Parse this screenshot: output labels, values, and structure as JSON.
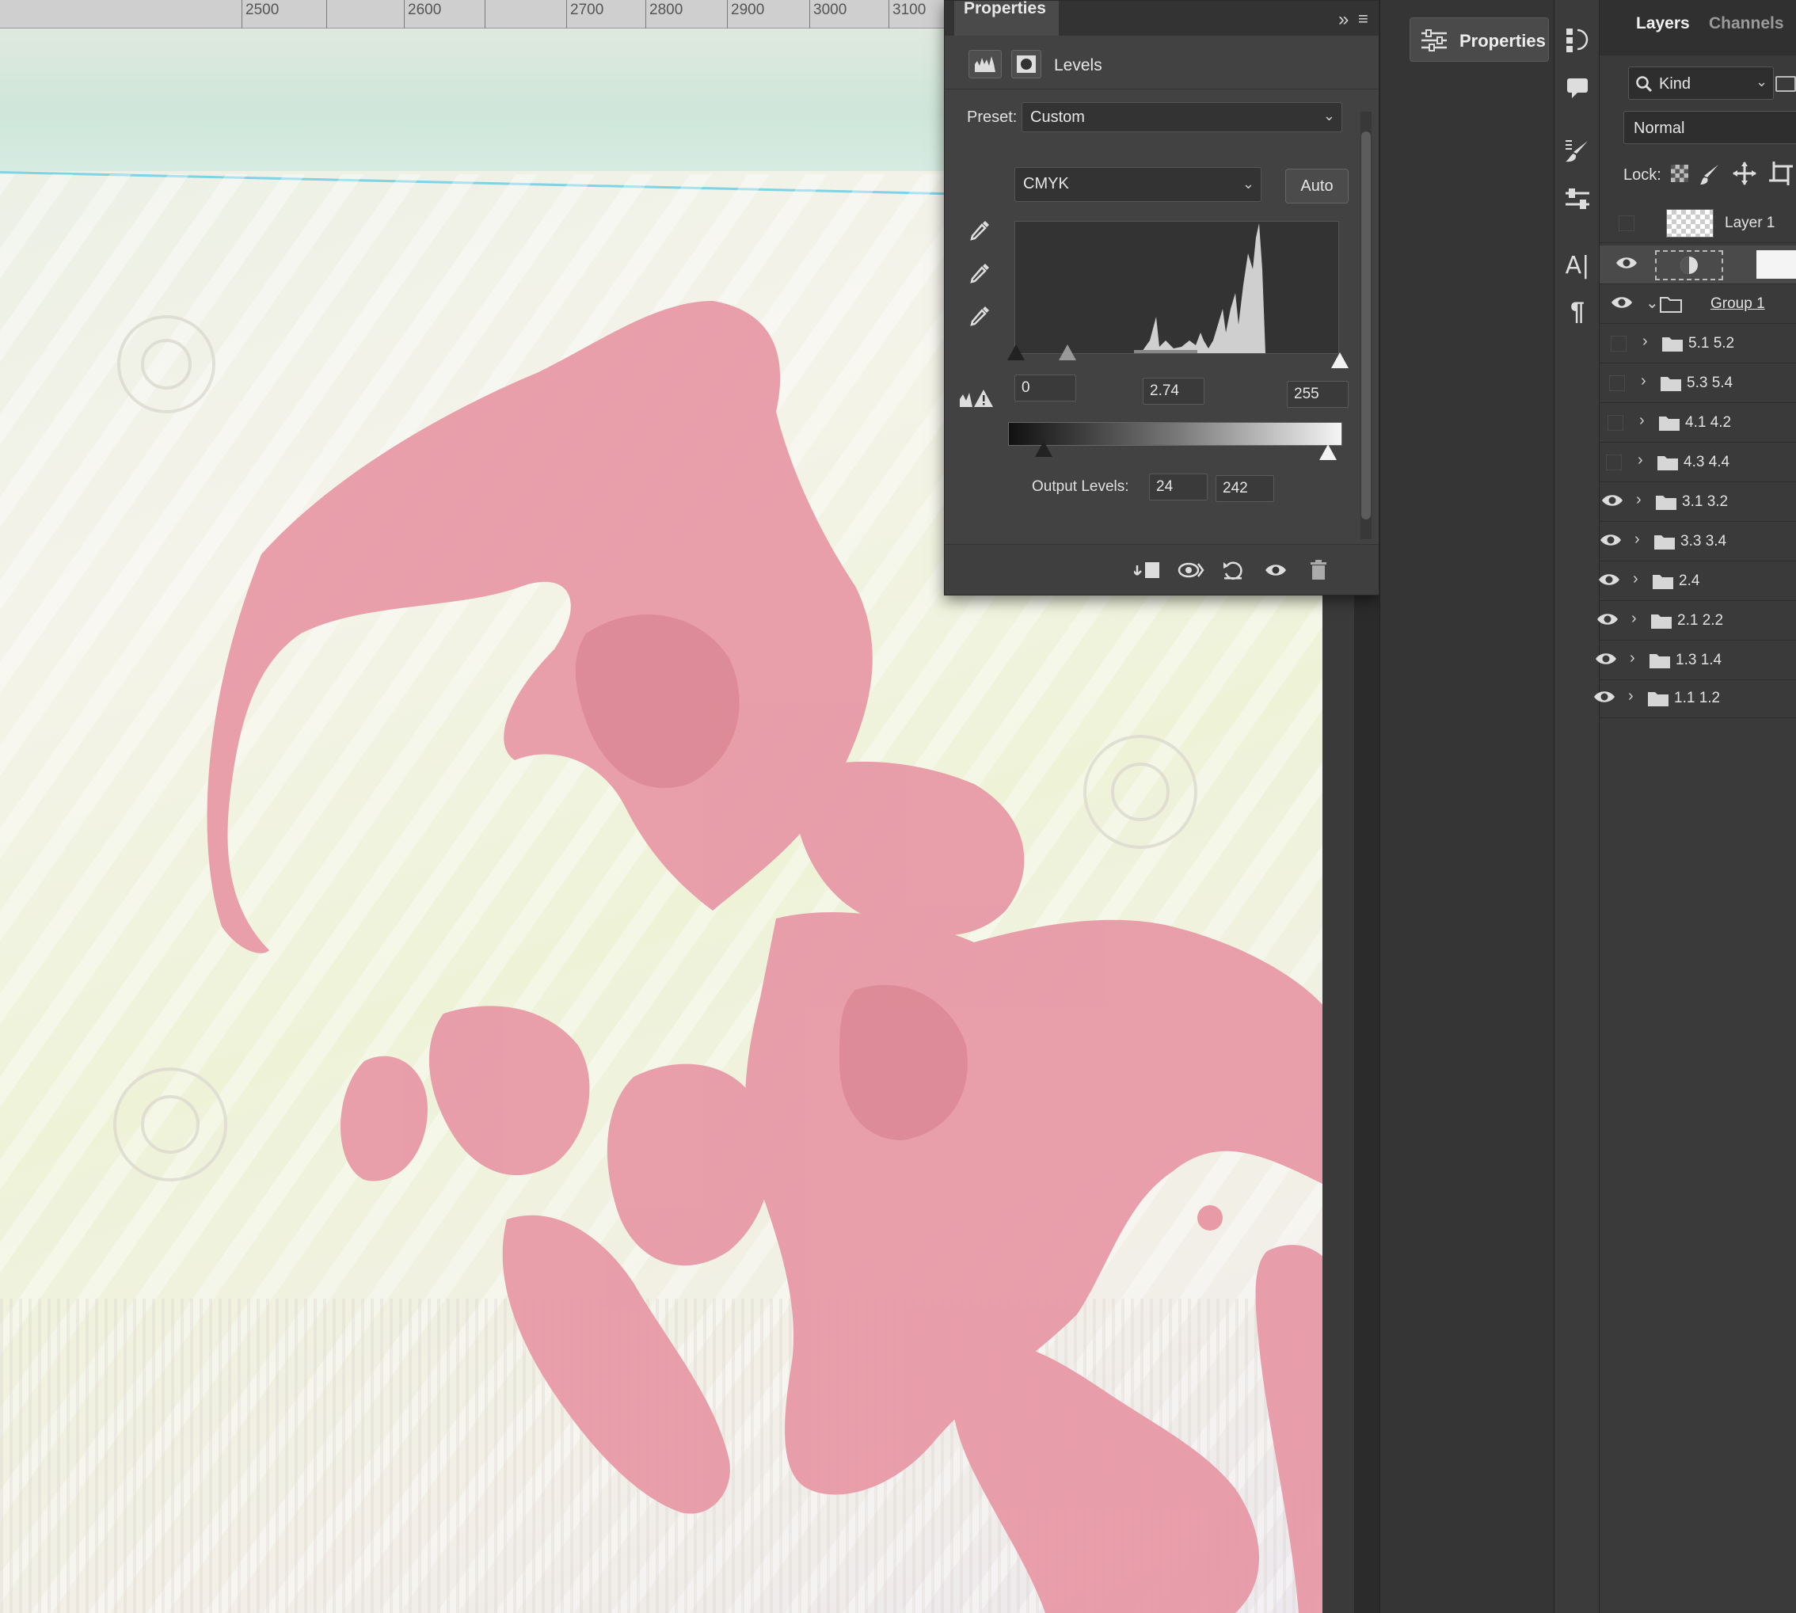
{
  "ruler": {
    "labels": [
      "2500",
      "2600",
      "2700",
      "2800",
      "2900",
      "3000",
      "3100"
    ]
  },
  "properties_panel": {
    "tab_label": "Properties",
    "adjustment_title": "Levels",
    "preset_label": "Preset:",
    "preset_value": "Custom",
    "channel_value": "CMYK",
    "auto_label": "Auto",
    "input_black": "0",
    "input_gamma": "2.74",
    "input_white": "255",
    "output_label": "Output Levels:",
    "output_black": "24",
    "output_white": "242"
  },
  "dock": {
    "properties_button_label": "Properties"
  },
  "layers_panel": {
    "tabs": [
      "Layers",
      "Channels"
    ],
    "kind_filter": "Kind",
    "blend_mode": "Normal",
    "lock_label": "Lock:",
    "layers": [
      {
        "name": "Layer 1",
        "visible": false,
        "type": "pixel"
      },
      {
        "name": "",
        "visible": true,
        "type": "adjustment"
      },
      {
        "name": "Group 1",
        "visible": true,
        "type": "group-open"
      },
      {
        "name": "5.1 5.2",
        "visible": false,
        "type": "group"
      },
      {
        "name": "5.3 5.4",
        "visible": false,
        "type": "group"
      },
      {
        "name": "4.1 4.2",
        "visible": false,
        "type": "group"
      },
      {
        "name": "4.3 4.4",
        "visible": false,
        "type": "group"
      },
      {
        "name": "3.1 3.2",
        "visible": true,
        "type": "group"
      },
      {
        "name": "3.3 3.4",
        "visible": true,
        "type": "group"
      },
      {
        "name": "2.4",
        "visible": true,
        "type": "group"
      },
      {
        "name": "2.1 2.2",
        "visible": true,
        "type": "group"
      },
      {
        "name": "1.3 1.4",
        "visible": true,
        "type": "group"
      },
      {
        "name": "1.1 1.2",
        "visible": true,
        "type": "group"
      }
    ]
  },
  "colors": {
    "panel_bg": "#424242",
    "stain_pink": "#e69aa6",
    "paper": "#f2f1e6",
    "guide": "#7fd3e6"
  }
}
